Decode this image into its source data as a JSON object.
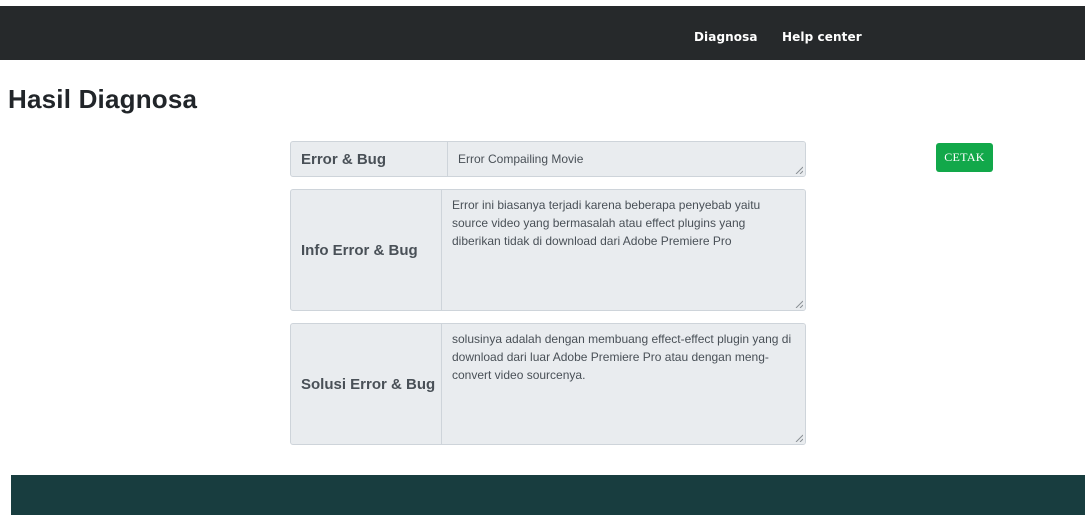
{
  "nav": {
    "links": [
      "Diagnosa",
      "Help center"
    ]
  },
  "page": {
    "title": "Hasil Diagnosa"
  },
  "result": {
    "error_bug": {
      "label": "Error & Bug",
      "value": "Error Compailing Movie"
    },
    "info": {
      "label": "Info Error & Bug",
      "value": "Error ini biasanya terjadi karena beberapa penyebab yaitu source video yang bermasalah atau effect plugins yang diberikan tidak di download dari Adobe Premiere Pro"
    },
    "solusi": {
      "label": "Solusi Error & Bug",
      "value": "solusinya adalah dengan membuang effect-effect plugin yang di download dari luar Adobe Premiere Pro atau dengan meng-convert video sourcenya."
    }
  },
  "actions": {
    "print_label": "CETAK"
  },
  "colors": {
    "navbar": "#26292b",
    "print_button": "#12a84a",
    "footer": "#183d3f",
    "field_bg": "#e9ecef"
  }
}
